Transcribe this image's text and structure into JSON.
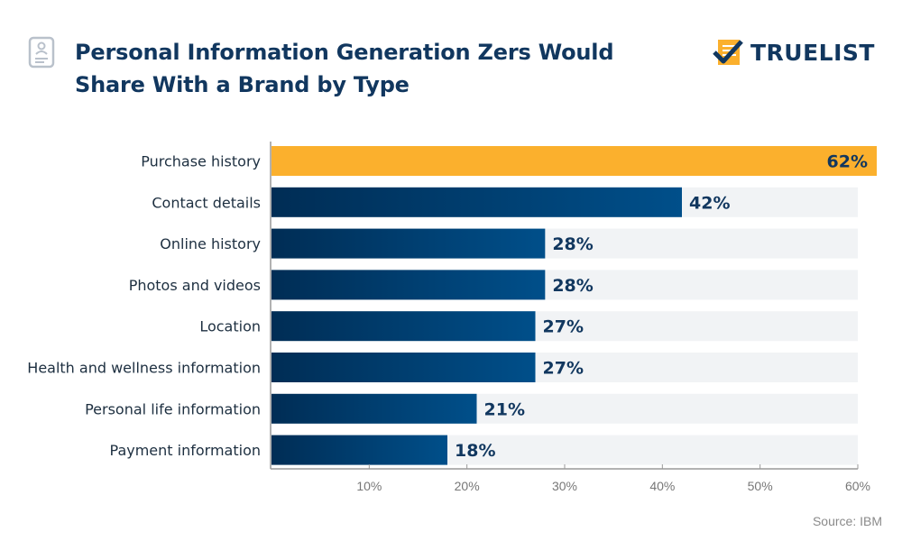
{
  "header": {
    "title_line1": "Personal Information Generation Zers Would",
    "title_line2": "Share With a Brand by Type",
    "icon": "profile-document-icon"
  },
  "logo": {
    "text": "TRUELIST",
    "icon": "checklist-icon",
    "colors": {
      "check": "#11375f",
      "paper": "#fbb02d"
    }
  },
  "source": "Source: IBM",
  "colors": {
    "highlight": "#fbb02d",
    "bar_dark": "#002d55",
    "bar_light": "#004f8a",
    "track": "#f1f3f5",
    "label_text": "#1d2f40",
    "value_text": "#11375f",
    "axis": "#999999",
    "tick_text": "#777777"
  },
  "chart_data": {
    "type": "bar",
    "orientation": "horizontal",
    "title": "Personal Information Generation Zers Would Share With a Brand by Type",
    "categories": [
      "Purchase history",
      "Contact details",
      "Online history",
      "Photos and videos",
      "Location",
      "Health and wellness information",
      "Personal life information",
      "Payment information"
    ],
    "values": [
      62,
      42,
      28,
      28,
      27,
      27,
      21,
      18
    ],
    "value_labels": [
      "62%",
      "42%",
      "28%",
      "28%",
      "27%",
      "27%",
      "21%",
      "18%"
    ],
    "highlight_index": 0,
    "xlabel": "",
    "ylabel": "",
    "xlim": [
      0,
      60
    ],
    "xticks": [
      10,
      20,
      30,
      40,
      50,
      60
    ],
    "xtick_labels": [
      "10%",
      "20%",
      "30%",
      "40%",
      "50%",
      "60%"
    ],
    "grid": false,
    "legend": "none"
  }
}
